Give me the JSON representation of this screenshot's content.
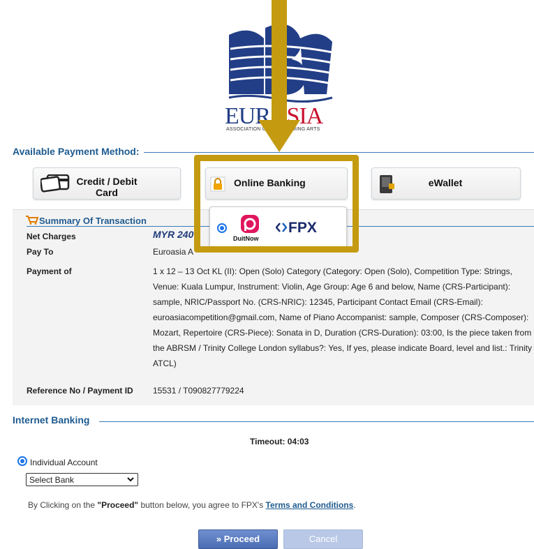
{
  "logo": {
    "brand_left": "EUR",
    "brand_right": "ASIA",
    "subtitle": "ASSOCIATION OF PERFORMING ARTS"
  },
  "payment_method": {
    "title": "Available Payment Method:",
    "tabs": [
      {
        "label": "Credit / Debit Card",
        "icon": "credit-card-icon"
      },
      {
        "label": "Online Banking",
        "icon": "lock-icon"
      },
      {
        "label": "eWallet",
        "icon": "wallet-icon"
      }
    ],
    "online_option": {
      "duitnow_label": "DuitNow",
      "fpx_label": "FPX"
    }
  },
  "summary": {
    "title": "Summary Of Transaction",
    "net_charges_label": "Net Charges",
    "net_charges_value": "MYR 240",
    "pay_to_label": "Pay To",
    "pay_to_value": "Euroasia A",
    "payment_of_label": "Payment of",
    "payment_of_value": "1 x 12 – 13 Oct KL (II): Open (Solo) Category (Category: Open (Solo), Competition Type: Strings, Venue: Kuala Lumpur, Instrument: Violin, Age Group: Age 6 and below, Name (CRS-Participant): sample, NRIC/Passport No. (CRS-NRIC): 12345, Participant Contact Email (CRS-Email): euroasiacompetition@gmail.com, Name of Piano Accompanist: sample, Composer (CRS-Composer): Mozart, Repertoire (CRS-Piece): Sonata in D, Duration (CRS-Duration): 03:00, Is the piece taken from the ABRSM / Trinity College London syllabus?: Yes, If yes, please indicate Board, level and list.: Trinity ATCL)",
    "reference_label": "Reference No / Payment ID",
    "reference_value": "15531 / T090827779224"
  },
  "internet_banking": {
    "title": "Internet Banking",
    "timeout": "Timeout: 04:03",
    "account_type_label": "Individual Account",
    "select_bank_value": "Select Bank",
    "agree_prefix": "By Clicking on the ",
    "agree_bold": "\"Proceed\"",
    "agree_middle": " button below, you agree to FPX's ",
    "terms_link": "Terms and Conditions",
    "agree_suffix": ".",
    "proceed_label": "» Proceed",
    "cancel_label": "Cancel"
  },
  "colors": {
    "highlight": "#c49a10",
    "section_title": "#1f5b8f",
    "proceed": "#4b6db3",
    "duitnow": "#e0165e",
    "fpx": "#1a2a6c"
  }
}
